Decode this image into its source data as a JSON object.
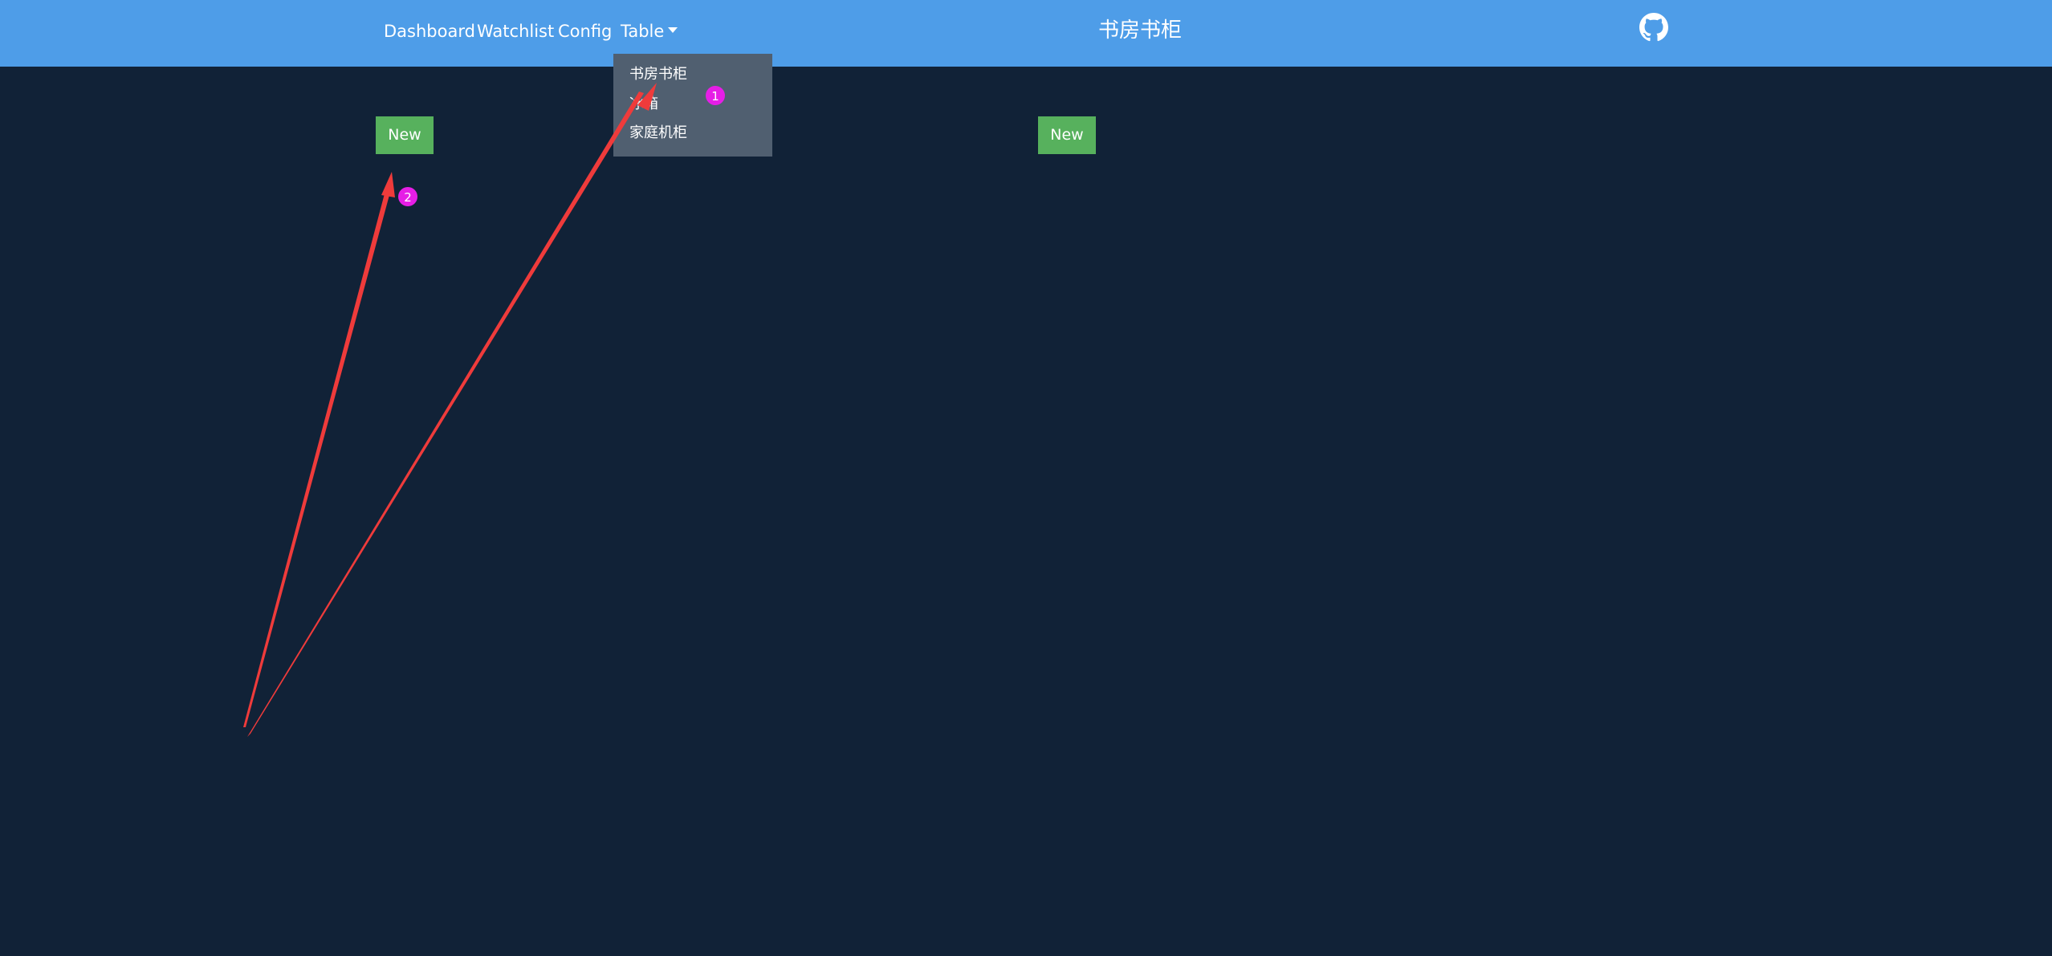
{
  "nav": {
    "links": [
      "Dashboard",
      "Watchlist",
      "Config",
      "Table"
    ],
    "title": "书房书柜",
    "github_icon": "github-icon"
  },
  "dropdown": {
    "items": [
      "书房书柜",
      "冰箱",
      "家庭机柜"
    ]
  },
  "buttons": {
    "new_left": "New",
    "new_right": "New"
  },
  "annotations": {
    "marker_1": "1",
    "marker_2": "2",
    "arrow_color": "#ef3b3b",
    "marker_color": "#e61ee6"
  },
  "colors": {
    "navbar": "#4e9de8",
    "background": "#112237",
    "dropdown": "#505f70",
    "button": "#57b15d"
  }
}
